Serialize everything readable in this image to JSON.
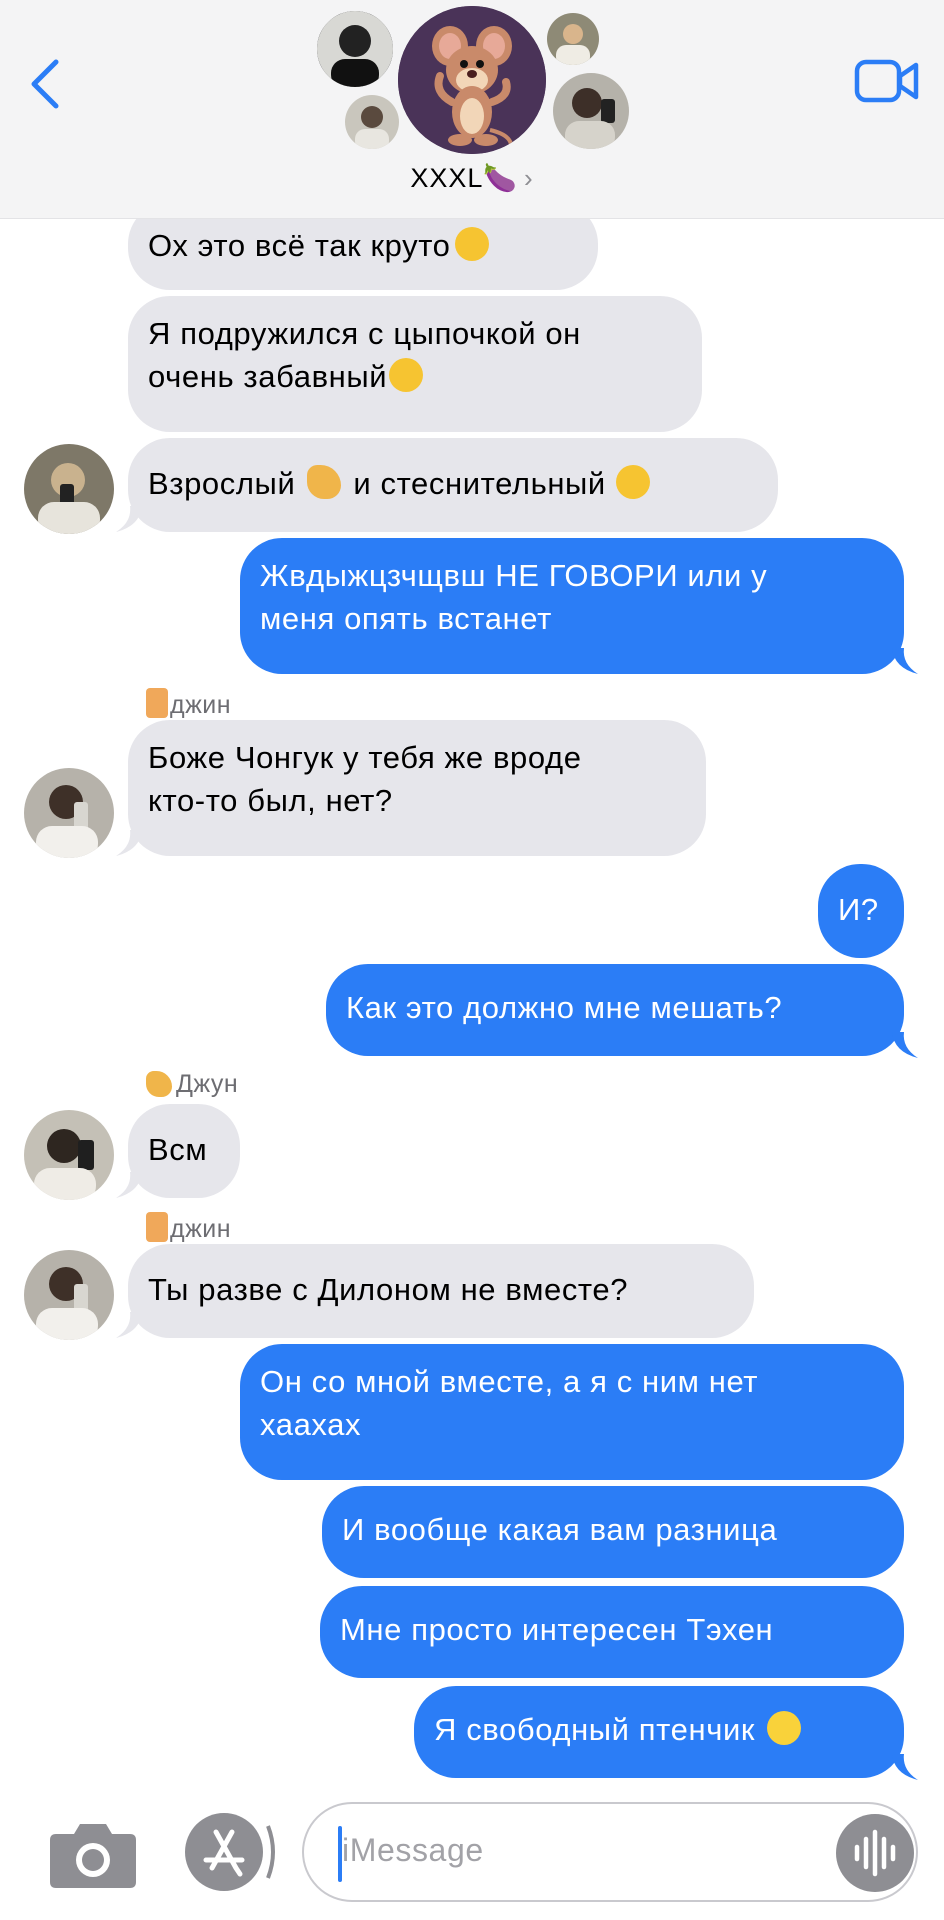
{
  "header": {
    "group_name": "XXXL🍆",
    "chevron": "›"
  },
  "messages": [
    {
      "dir": "in",
      "lines": [
        "Ох это всё так круто"
      ],
      "emoji": "face-hand-over-mouth"
    },
    {
      "dir": "in",
      "lines": [
        "Я подружился с цыпочкой он",
        "очень забавный"
      ],
      "emoji": "zany-face"
    },
    {
      "dir": "in",
      "parts": [
        "Взрослый",
        "и стеснительный"
      ],
      "emoji": [
        "flexed-biceps",
        "face-holding-back-tears"
      ]
    },
    {
      "dir": "out",
      "lines": [
        "Жвдыжцзчщвш НЕ ГОВОРИ  или у",
        "меня опять встанет"
      ]
    },
    {
      "dir": "sender",
      "name": "джин",
      "emoji": "beverage-box"
    },
    {
      "dir": "in",
      "lines": [
        "Боже Чонгук у тебя же вроде",
        "кто-то был,  нет?"
      ]
    },
    {
      "dir": "out",
      "lines": [
        "И?"
      ]
    },
    {
      "dir": "out",
      "lines": [
        "Как это должно мне мешать?"
      ]
    },
    {
      "dir": "sender",
      "name": "Джун",
      "emoji": "flexed-biceps"
    },
    {
      "dir": "in",
      "lines": [
        "Всм"
      ]
    },
    {
      "dir": "sender",
      "name": "джин",
      "emoji": "beverage-box"
    },
    {
      "dir": "in",
      "lines": [
        "Ты разве с Дилоном не вместе?"
      ]
    },
    {
      "dir": "out",
      "lines": [
        "Он со мной вместе,  а я с ним нет",
        "хаахах"
      ]
    },
    {
      "dir": "out",
      "lines": [
        "И вообще какая вам разница"
      ]
    },
    {
      "dir": "out",
      "lines": [
        "Мне просто интересен Тэхен"
      ]
    },
    {
      "dir": "out",
      "lines": [
        "Я свободный птенчик"
      ],
      "emoji": "baby-chick"
    }
  ],
  "input": {
    "placeholder": "iMessage"
  },
  "colors": {
    "outgoing_bubble": "#2b7df6",
    "incoming_bubble": "#e6e6eb",
    "header_bg": "#f4f4f5",
    "accent": "#2b7df6"
  },
  "icons": [
    "back-chevron-icon",
    "video-camera-icon",
    "camera-icon",
    "app-store-icon",
    "voice-waveform-icon"
  ]
}
